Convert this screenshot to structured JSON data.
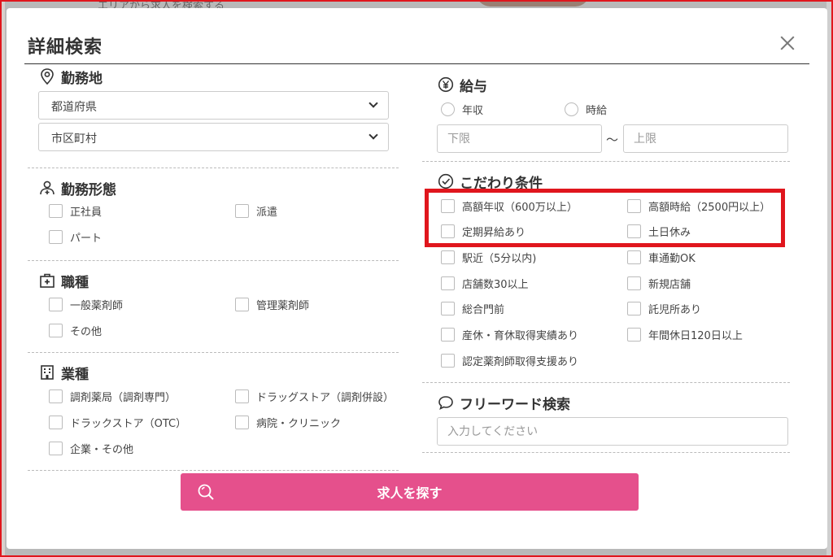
{
  "background": {
    "partial_text": "エリアから求人を検索する"
  },
  "modal": {
    "title": "詳細検索",
    "close_label": "×"
  },
  "workplace": {
    "heading": "勤務地",
    "prefecture_placeholder": "都道府県",
    "city_placeholder": "市区町村"
  },
  "employment": {
    "heading": "勤務形態",
    "options": [
      "正社員",
      "派遣",
      "パート"
    ]
  },
  "occupation": {
    "heading": "職種",
    "options": [
      "一般薬剤師",
      "管理薬剤師",
      "その他"
    ]
  },
  "industry": {
    "heading": "業種",
    "options": [
      "調剤薬局（調剤専門）",
      "ドラッグストア（調剤併設）",
      "ドラックストア（OTC）",
      "病院・クリニック",
      "企業・その他"
    ]
  },
  "salary": {
    "heading": "給与",
    "type_options": [
      "年収",
      "時給"
    ],
    "min_placeholder": "下限",
    "range_separator": "～",
    "max_placeholder": "上限"
  },
  "preferences": {
    "heading": "こだわり条件",
    "options": [
      "高額年収（600万以上）",
      "高額時給（2500円以上）",
      "定期昇給あり",
      "土日休み",
      "駅近（5分以内)",
      "車通勤OK",
      "店舗数30以上",
      "新規店舗",
      "総合門前",
      "託児所あり",
      "産休・育休取得実績あり",
      "年間休日120日以上",
      "認定薬剤師取得支援あり"
    ]
  },
  "freeword": {
    "heading": "フリーワード検索",
    "placeholder": "入力してください"
  },
  "search_button": {
    "label": "求人を探す"
  },
  "colors": {
    "accent": "#e5508c",
    "highlight": "#e0161d"
  }
}
